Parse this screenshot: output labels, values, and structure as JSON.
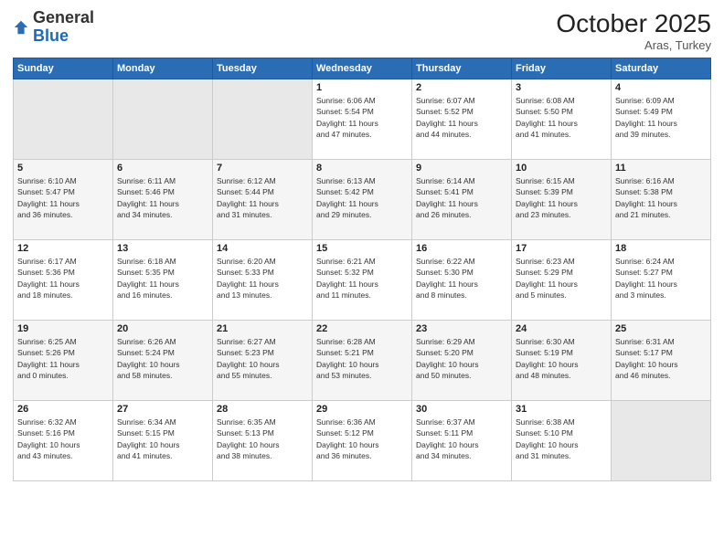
{
  "logo": {
    "general": "General",
    "blue": "Blue"
  },
  "header": {
    "month": "October 2025",
    "location": "Aras, Turkey"
  },
  "weekdays": [
    "Sunday",
    "Monday",
    "Tuesday",
    "Wednesday",
    "Thursday",
    "Friday",
    "Saturday"
  ],
  "weeks": [
    [
      {
        "day": "",
        "info": ""
      },
      {
        "day": "",
        "info": ""
      },
      {
        "day": "",
        "info": ""
      },
      {
        "day": "1",
        "info": "Sunrise: 6:06 AM\nSunset: 5:54 PM\nDaylight: 11 hours\nand 47 minutes."
      },
      {
        "day": "2",
        "info": "Sunrise: 6:07 AM\nSunset: 5:52 PM\nDaylight: 11 hours\nand 44 minutes."
      },
      {
        "day": "3",
        "info": "Sunrise: 6:08 AM\nSunset: 5:50 PM\nDaylight: 11 hours\nand 41 minutes."
      },
      {
        "day": "4",
        "info": "Sunrise: 6:09 AM\nSunset: 5:49 PM\nDaylight: 11 hours\nand 39 minutes."
      }
    ],
    [
      {
        "day": "5",
        "info": "Sunrise: 6:10 AM\nSunset: 5:47 PM\nDaylight: 11 hours\nand 36 minutes."
      },
      {
        "day": "6",
        "info": "Sunrise: 6:11 AM\nSunset: 5:46 PM\nDaylight: 11 hours\nand 34 minutes."
      },
      {
        "day": "7",
        "info": "Sunrise: 6:12 AM\nSunset: 5:44 PM\nDaylight: 11 hours\nand 31 minutes."
      },
      {
        "day": "8",
        "info": "Sunrise: 6:13 AM\nSunset: 5:42 PM\nDaylight: 11 hours\nand 29 minutes."
      },
      {
        "day": "9",
        "info": "Sunrise: 6:14 AM\nSunset: 5:41 PM\nDaylight: 11 hours\nand 26 minutes."
      },
      {
        "day": "10",
        "info": "Sunrise: 6:15 AM\nSunset: 5:39 PM\nDaylight: 11 hours\nand 23 minutes."
      },
      {
        "day": "11",
        "info": "Sunrise: 6:16 AM\nSunset: 5:38 PM\nDaylight: 11 hours\nand 21 minutes."
      }
    ],
    [
      {
        "day": "12",
        "info": "Sunrise: 6:17 AM\nSunset: 5:36 PM\nDaylight: 11 hours\nand 18 minutes."
      },
      {
        "day": "13",
        "info": "Sunrise: 6:18 AM\nSunset: 5:35 PM\nDaylight: 11 hours\nand 16 minutes."
      },
      {
        "day": "14",
        "info": "Sunrise: 6:20 AM\nSunset: 5:33 PM\nDaylight: 11 hours\nand 13 minutes."
      },
      {
        "day": "15",
        "info": "Sunrise: 6:21 AM\nSunset: 5:32 PM\nDaylight: 11 hours\nand 11 minutes."
      },
      {
        "day": "16",
        "info": "Sunrise: 6:22 AM\nSunset: 5:30 PM\nDaylight: 11 hours\nand 8 minutes."
      },
      {
        "day": "17",
        "info": "Sunrise: 6:23 AM\nSunset: 5:29 PM\nDaylight: 11 hours\nand 5 minutes."
      },
      {
        "day": "18",
        "info": "Sunrise: 6:24 AM\nSunset: 5:27 PM\nDaylight: 11 hours\nand 3 minutes."
      }
    ],
    [
      {
        "day": "19",
        "info": "Sunrise: 6:25 AM\nSunset: 5:26 PM\nDaylight: 11 hours\nand 0 minutes."
      },
      {
        "day": "20",
        "info": "Sunrise: 6:26 AM\nSunset: 5:24 PM\nDaylight: 10 hours\nand 58 minutes."
      },
      {
        "day": "21",
        "info": "Sunrise: 6:27 AM\nSunset: 5:23 PM\nDaylight: 10 hours\nand 55 minutes."
      },
      {
        "day": "22",
        "info": "Sunrise: 6:28 AM\nSunset: 5:21 PM\nDaylight: 10 hours\nand 53 minutes."
      },
      {
        "day": "23",
        "info": "Sunrise: 6:29 AM\nSunset: 5:20 PM\nDaylight: 10 hours\nand 50 minutes."
      },
      {
        "day": "24",
        "info": "Sunrise: 6:30 AM\nSunset: 5:19 PM\nDaylight: 10 hours\nand 48 minutes."
      },
      {
        "day": "25",
        "info": "Sunrise: 6:31 AM\nSunset: 5:17 PM\nDaylight: 10 hours\nand 46 minutes."
      }
    ],
    [
      {
        "day": "26",
        "info": "Sunrise: 6:32 AM\nSunset: 5:16 PM\nDaylight: 10 hours\nand 43 minutes."
      },
      {
        "day": "27",
        "info": "Sunrise: 6:34 AM\nSunset: 5:15 PM\nDaylight: 10 hours\nand 41 minutes."
      },
      {
        "day": "28",
        "info": "Sunrise: 6:35 AM\nSunset: 5:13 PM\nDaylight: 10 hours\nand 38 minutes."
      },
      {
        "day": "29",
        "info": "Sunrise: 6:36 AM\nSunset: 5:12 PM\nDaylight: 10 hours\nand 36 minutes."
      },
      {
        "day": "30",
        "info": "Sunrise: 6:37 AM\nSunset: 5:11 PM\nDaylight: 10 hours\nand 34 minutes."
      },
      {
        "day": "31",
        "info": "Sunrise: 6:38 AM\nSunset: 5:10 PM\nDaylight: 10 hours\nand 31 minutes."
      },
      {
        "day": "",
        "info": ""
      }
    ]
  ]
}
